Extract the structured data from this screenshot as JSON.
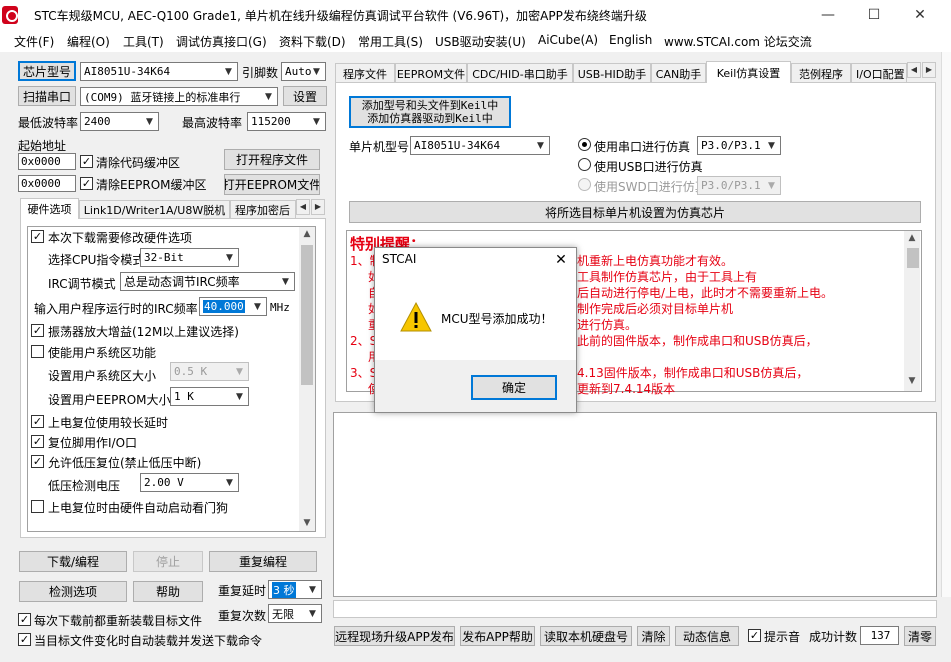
{
  "window": {
    "title": "STC车规级MCU, AEC-Q100 Grade1, 单片机在线升级编程仿真调试平台软件 (V6.96T)，加密APP发布绕终端升级",
    "minimize": "—",
    "maximize": "☐",
    "close": "✕"
  },
  "menu": [
    "文件(F)",
    "编程(O)",
    "工具(T)",
    "调试仿真接口(G)",
    "资料下载(D)",
    "常用工具(S)",
    "USB驱动安装(U)",
    "AiCube(A)",
    "English",
    "www.STCAI.com 论坛交流"
  ],
  "left": {
    "chip_model_button": "芯片型号",
    "chip_model_value": "AI8051U-34K64",
    "pin_count_label": "引脚数",
    "pin_count_value": "Auto",
    "scan_port_button": "扫描串口",
    "port_value": "(COM9) 蓝牙链接上的标准串行",
    "settings_button": "设置",
    "min_baud_label": "最低波特率",
    "min_baud_value": "2400",
    "max_baud_label": "最高波特率",
    "max_baud_value": "115200",
    "start_addr_label": "起始地址",
    "code_addr": "0x0000",
    "clear_code_label": "清除代码缓冲区",
    "open_program_button": "打开程序文件",
    "eeprom_addr": "0x0000",
    "clear_eeprom_label": "清除EEPROM缓冲区",
    "open_eeprom_button": "打开EEPROM文件",
    "tabs": [
      "硬件选项",
      "Link1D/Writer1A/U8W脱机",
      "程序加密后"
    ],
    "hw": {
      "modify_hw_label": "本次下载需要修改硬件选项",
      "cpu_mode_label": "选择CPU指令模式",
      "cpu_mode_value": "32-Bit",
      "irc_mode_label": "IRC调节模式",
      "irc_mode_value": "总是动态调节IRC频率",
      "irc_freq_label": "输入用户程序运行时的IRC频率",
      "irc_freq_value": "40.000",
      "irc_freq_unit": "MHz",
      "osc_gain_label": "振荡器放大增益(12M以上建议选择)",
      "sys_area_label": "使能用户系统区功能",
      "sys_area_size_label": "设置用户系统区大小",
      "sys_area_size_value": "0.5 K",
      "eeprom_size_label": "设置用户EEPROM大小",
      "eeprom_size_value": "1   K",
      "long_reset_label": "上电复位使用较长延时",
      "reset_io_label": "复位脚用作I/O口",
      "lvr_label": "允许低压复位(禁止低压中断)",
      "lvd_label": "低压检测电压",
      "lvd_value": "2.00 V",
      "watchdog_label": "上电复位时由硬件自动启动看门狗"
    },
    "download_button": "下载/编程",
    "stop_button": "停止",
    "reprogram_button": "重复编程",
    "check_button": "检测选项",
    "help_button": "帮助",
    "repeat_delay_label": "重复延时",
    "repeat_delay_value": "3 秒",
    "repeat_count_label": "重复次数",
    "repeat_count_value": "无限",
    "reload_label": "每次下载前都重新装载目标文件",
    "auto_send_label": "当目标文件变化时自动装载并发送下载命令"
  },
  "right": {
    "tabs": [
      "程序文件",
      "EEPROM文件",
      "CDC/HID-串口助手",
      "USB-HID助手",
      "CAN助手",
      "Keil仿真设置",
      "范例程序",
      "I/O口配置"
    ],
    "add_keil_line1": "添加型号和头文件到Keil中",
    "add_keil_line2": "添加仿真器驱动到Keil中",
    "mcu_model_label": "单片机型号",
    "mcu_model_value": "AI8051U-34K64",
    "uart_emu_label": "使用串口进行仿真",
    "uart_emu_value": "P3.0/P3.1",
    "usb_emu_label": "使用USB口进行仿真",
    "swd_emu_label": "使用SWD口进行仿真",
    "swd_emu_value": "P3.0/P3.1",
    "set_target_button": "将所选目标单片机设置为仿真芯片",
    "notice_title": "特别提醒：",
    "notice_lines": [
      "1、制",
      "如",
      "自",
      "如",
      "重",
      "2、S",
      "用",
      "3、S",
      "使"
    ],
    "notice_lines_right": [
      "机重新上电仿真功能才有效。",
      "工具制作仿真芯片，由于工具上有",
      "后自动进行停电/上电，此时才不需要重新上电。",
      "制作完成后必须对目标单片机",
      "进行仿真。",
      "此前的固件版本，制作成串口和USB仿真后，",
      "",
      "4.13固件版本，制作成串口和USB仿真后，",
      "更新到7.4.14版本"
    ],
    "btn_remote_upgrade": "远程现场升级APP发布",
    "btn_publish_help": "发布APP帮助",
    "btn_read_disk": "读取本机硬盘号",
    "btn_clear": "清除",
    "btn_anim": "动态信息",
    "beep_label": "提示音",
    "success_count_label": "成功计数",
    "success_count_value": "137",
    "btn_clear_count": "清零"
  },
  "dialog": {
    "title": "STCAI",
    "message": "MCU型号添加成功！",
    "ok_button": "确定",
    "close": "✕"
  },
  "colors": {
    "accent": "#0078d7",
    "warning_red": "#e60012",
    "warning_icon": "#f7c600"
  }
}
